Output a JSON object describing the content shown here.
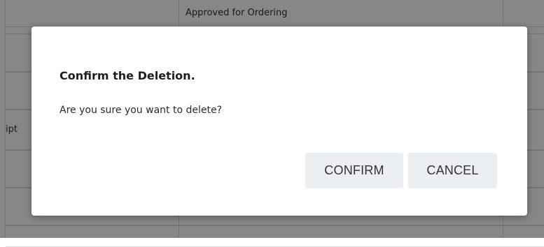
{
  "background": {
    "row_status_text": "Approved for Ordering",
    "left_cell_fragment": "ipt"
  },
  "dialog": {
    "title": "Confirm the Deletion.",
    "message": "Are you sure you want to delete?",
    "confirm_label": "CONFIRM",
    "cancel_label": "CANCEL"
  }
}
